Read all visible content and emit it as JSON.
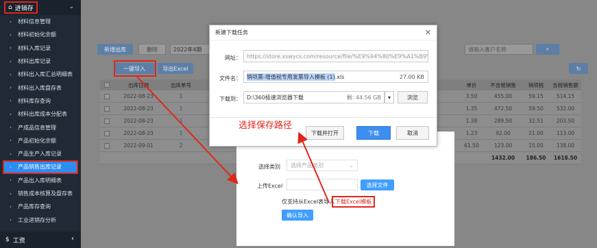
{
  "sidebar": {
    "header": "进销存",
    "items": [
      "材料信息管理",
      "材料初始化余额",
      "材料入库记录",
      "材料出库记录",
      "材料出入库汇总明细表",
      "材料出入库盘存表",
      "材料库存查询",
      "材料出库成本分配表",
      "产成品信息管理",
      "产品初始化余额",
      "产品生产入库记录",
      "产品销售出库记录",
      "产品出入库明细表",
      "销售成本核算及盘存表",
      "产品库存查询",
      "工业进销存分析"
    ],
    "active_index": 11,
    "footer": "工资"
  },
  "toolbar": {
    "new_out": "新增出库",
    "delete": "删除",
    "period": "2022年4期",
    "search_placeholder": "请输入客户名称",
    "import": "一键导入",
    "export": "导出Excel"
  },
  "table": {
    "headers": [
      "出库日期",
      "出库单号",
      "单价",
      "不含税销售",
      "销项税",
      "含税销售额"
    ],
    "rows": [
      [
        "2022-08-23",
        "1",
        "3.50",
        "455.00",
        "59.15",
        "514.15"
      ],
      [
        "2022-08-23",
        "1",
        "1.35",
        "472.50",
        "59.50",
        "532.00"
      ],
      [
        "2022-08-23",
        "1",
        "1.38",
        "289.50",
        "32.51",
        "203.50"
      ],
      [
        "2022-08-23",
        "1",
        "1.23",
        "92.00",
        "21.00",
        "113.00"
      ],
      [
        "2022-09-01",
        "2",
        "61.50",
        "123.00",
        "15.00",
        "138.00"
      ]
    ],
    "totals": [
      "1432.00",
      "186.50",
      "1618.50"
    ]
  },
  "upload_dialog": {
    "select_label": "选择类别",
    "select_placeholder": "选择产品类别",
    "upload_label": "上传Excel",
    "choose_file": "选择文件",
    "hint": "仅支持从Excel表导入",
    "download_template": "下载Excel模板",
    "confirm": "确认导入"
  },
  "download_dialog": {
    "title": "新建下载任务",
    "url_label": "网址：",
    "url": "https://store.xswycs.com/resource/file/%E9%94%80%E9%A1%B9%E7%",
    "filename_label": "文件名：",
    "filename": "销项票-增值税专用发票导入模板 (1)",
    "filename_ext": ".xls",
    "filesize": "27.00 KB",
    "save_label": "下载到：",
    "save_path": "D:\\360极速浏览器下载",
    "free_space": "剩: 44.56 GB",
    "browse": "浏览",
    "download_open": "下载并打开",
    "download": "下载",
    "cancel": "取消"
  },
  "annotation": "选择保存路径",
  "colors": {
    "accent": "#409eff",
    "annotation": "#e0261b",
    "sidebar": "#1f2a36"
  }
}
